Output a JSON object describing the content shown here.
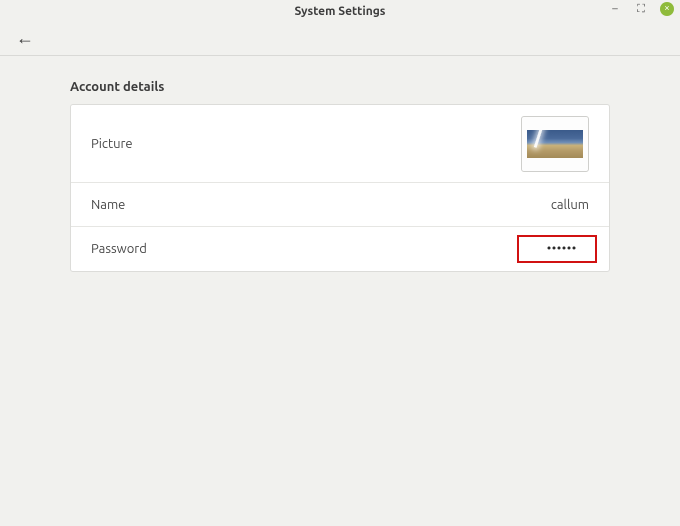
{
  "window": {
    "title": "System Settings"
  },
  "icons": {
    "minimize": "–",
    "maximize": "⛶",
    "back": "←"
  },
  "section": {
    "heading": "Account details",
    "rows": {
      "picture_label": "Picture",
      "name_label": "Name",
      "name_value": "callum",
      "password_label": "Password",
      "password_value": "••••••"
    }
  }
}
